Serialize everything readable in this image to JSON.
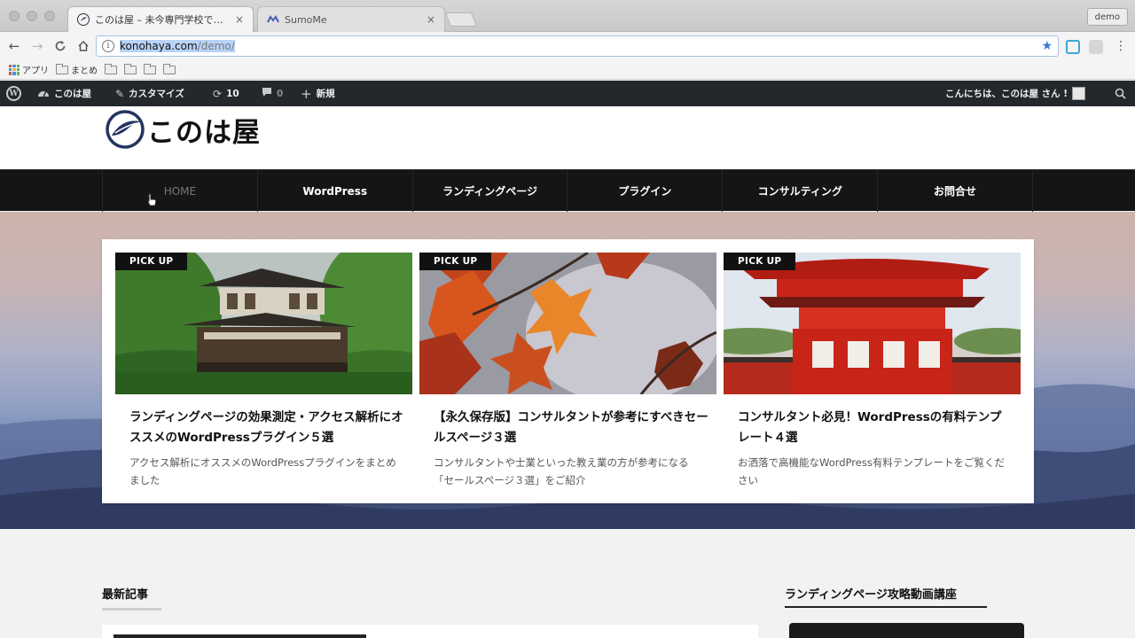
{
  "browser": {
    "tabs": [
      {
        "title": "このは屋 – 未今専門学校ではなる",
        "active": true
      },
      {
        "title": "SumoMe",
        "active": false
      }
    ],
    "profile": "demo",
    "url": {
      "host": "konohaya.com",
      "path": "/demo/"
    },
    "bookmarks": [
      {
        "label": "アプリ",
        "type": "apps"
      },
      {
        "label": "まとめ",
        "type": "folder"
      },
      {
        "label": "",
        "type": "folder"
      },
      {
        "label": "",
        "type": "folder"
      },
      {
        "label": "",
        "type": "folder"
      },
      {
        "label": "",
        "type": "folder"
      }
    ]
  },
  "adminbar": {
    "site": "このは屋",
    "customize": "カスタマイズ",
    "updates": "10",
    "comments": "0",
    "new": "新規",
    "greeting": "こんにちは、このは屋 さん !"
  },
  "site": {
    "logo_text": "このは屋",
    "nav": [
      "HOME",
      "WordPress",
      "ランディングページ",
      "プラグイン",
      "コンサルティング",
      "お問合せ"
    ],
    "current_nav": 0
  },
  "pickup": {
    "badge": "PICK UP",
    "cards": [
      {
        "image": "temple-pavilion",
        "title": "ランディングページの効果測定・アクセス解析にオススメのWordPressプラグイン５選",
        "excerpt": "アクセス解析にオススメのWordPressプラグインをまとめました"
      },
      {
        "image": "autumn-maple-leaves",
        "title": "【永久保存版】コンサルタントが参考にすべきセールスページ３選",
        "excerpt": "コンサルタントや士業といった教え業の方が参考になる「セールスページ３選」をご紹介"
      },
      {
        "image": "red-shrine-gate",
        "title": "コンサルタント必見！WordPressの有料テンプレート４選",
        "excerpt": "お洒落で高機能なWordPress有料テンプレートをご覧ください"
      }
    ]
  },
  "sections": {
    "latest": "最新記事",
    "sidebar_title": "ランディングページ攻略動画講座"
  },
  "colors": {
    "adminbar": "#23282d",
    "nav": "#151515",
    "accent_link": "#3b76d9"
  }
}
